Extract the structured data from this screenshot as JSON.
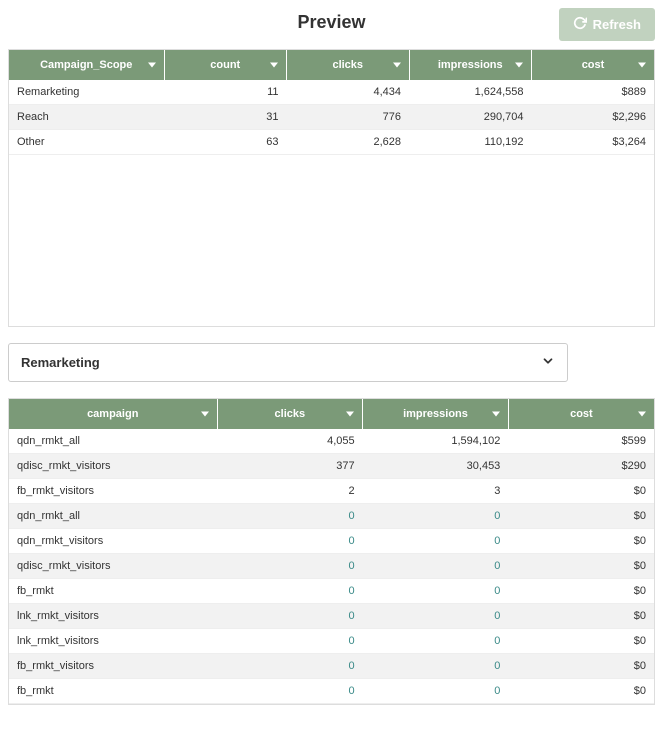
{
  "header": {
    "title": "Preview",
    "refresh_label": "Refresh"
  },
  "summary_table": {
    "columns": [
      "Campaign_Scope",
      "count",
      "clicks",
      "impressions",
      "cost"
    ],
    "rows": [
      {
        "scope": "Remarketing",
        "count": "11",
        "clicks": "4,434",
        "impressions": "1,624,558",
        "cost": "$889"
      },
      {
        "scope": "Reach",
        "count": "31",
        "clicks": "776",
        "impressions": "290,704",
        "cost": "$2,296"
      },
      {
        "scope": "Other",
        "count": "63",
        "clicks": "2,628",
        "impressions": "110,192",
        "cost": "$3,264"
      }
    ]
  },
  "filter": {
    "selected": "Remarketing"
  },
  "detail_table": {
    "columns": [
      "campaign",
      "clicks",
      "impressions",
      "cost"
    ],
    "rows": [
      {
        "campaign": "qdn_rmkt_all",
        "clicks": "4,055",
        "impressions": "1,594,102",
        "cost": "$599"
      },
      {
        "campaign": "qdisc_rmkt_visitors",
        "clicks": "377",
        "impressions": "30,453",
        "cost": "$290"
      },
      {
        "campaign": "fb_rmkt_visitors",
        "clicks": "2",
        "impressions": "3",
        "cost": "$0"
      },
      {
        "campaign": "qdn_rmkt_all",
        "clicks": "0",
        "impressions": "0",
        "cost": "$0"
      },
      {
        "campaign": "qdn_rmkt_visitors",
        "clicks": "0",
        "impressions": "0",
        "cost": "$0"
      },
      {
        "campaign": "qdisc_rmkt_visitors",
        "clicks": "0",
        "impressions": "0",
        "cost": "$0"
      },
      {
        "campaign": "fb_rmkt",
        "clicks": "0",
        "impressions": "0",
        "cost": "$0"
      },
      {
        "campaign": "lnk_rmkt_visitors",
        "clicks": "0",
        "impressions": "0",
        "cost": "$0"
      },
      {
        "campaign": "lnk_rmkt_visitors",
        "clicks": "0",
        "impressions": "0",
        "cost": "$0"
      },
      {
        "campaign": "fb_rmkt_visitors",
        "clicks": "0",
        "impressions": "0",
        "cost": "$0"
      },
      {
        "campaign": "fb_rmkt",
        "clicks": "0",
        "impressions": "0",
        "cost": "$0"
      }
    ]
  }
}
